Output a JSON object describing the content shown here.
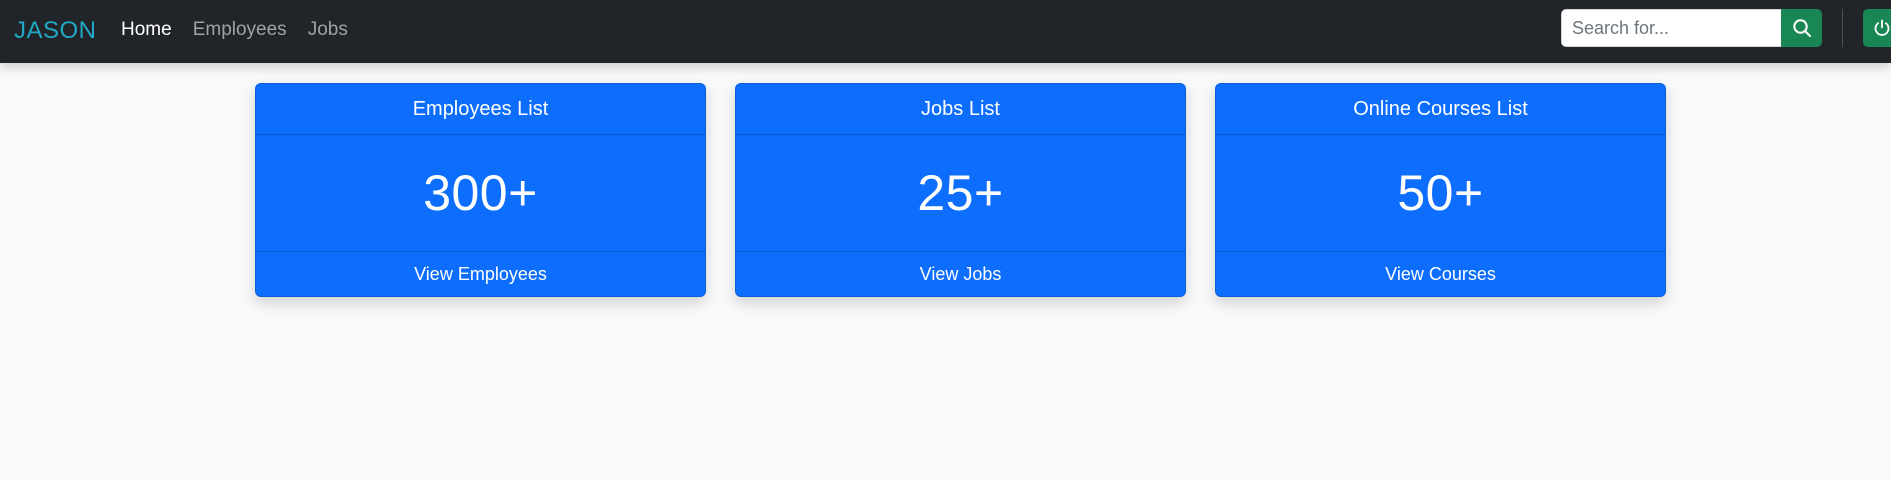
{
  "navbar": {
    "brand": "JASON",
    "links": [
      {
        "label": "Home",
        "active": true
      },
      {
        "label": "Employees",
        "active": false
      },
      {
        "label": "Jobs",
        "active": false
      }
    ],
    "search": {
      "placeholder": "Search for...",
      "value": "",
      "button_icon": "search-icon"
    },
    "logout_icon": "power-icon"
  },
  "cards": [
    {
      "title": "Employees List",
      "count": "300+",
      "footer": "View Employees"
    },
    {
      "title": "Jobs List",
      "count": "25+",
      "footer": "View Jobs"
    },
    {
      "title": "Online Courses List",
      "count": "50+",
      "footer": "View Courses"
    }
  ],
  "colors": {
    "navbar_bg": "#212529",
    "brand": "#20a9c4",
    "card_bg": "#0d6efd",
    "success": "#198754",
    "page_bg": "#f8f9fa"
  }
}
